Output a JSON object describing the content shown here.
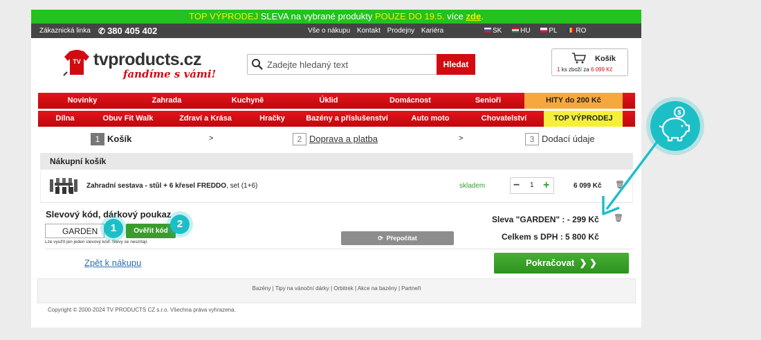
{
  "promo": {
    "part1": "TOP VÝPRODEJ",
    "part2": "SLEVA",
    "part3": "na vybrané produkty",
    "part4": "POUZE DO 19.5.",
    "part5": "více",
    "link": "zde",
    "end": "."
  },
  "topbar": {
    "customer_line": "Zákaznická linka",
    "phone": "380 405 402",
    "nav": [
      "Vše o nákupu",
      "Kontakt",
      "Prodejny",
      "Kariéra"
    ],
    "langs": [
      "SK",
      "HU",
      "PL",
      "RO"
    ]
  },
  "logo": {
    "brand": "tvproducts.cz",
    "slogan": "fandíme s vámi!",
    "badge": "TV"
  },
  "search": {
    "placeholder": "Zadejte hledaný text",
    "button": "Hledat"
  },
  "cart": {
    "title": "Košík",
    "count": "1",
    "mid": "ks zboží za",
    "price": "6 099 Kč"
  },
  "menu1": [
    "Novinky",
    "Zahrada",
    "Kuchyně",
    "Úklid",
    "Domácnost",
    "Senioři",
    "HITY do 200 Kč"
  ],
  "menu2": [
    "Dílna",
    "Obuv Fit Walk",
    "Zdraví a Krása",
    "Hračky",
    "Bazény a příslušenství",
    "Auto moto",
    "Chovatelství",
    "TOP VÝPRODEJ"
  ],
  "steps": [
    {
      "num": "1",
      "label": "Košík"
    },
    {
      "num": "2",
      "label": "Doprava a platba"
    },
    {
      "num": "3",
      "label": "Dodací údaje"
    }
  ],
  "step_arrow": ">",
  "panel": {
    "title": "Nákupní košík"
  },
  "item": {
    "name_bold": "Zahradní sestava - stůl + 6 křesel FREDDO",
    "name_rest": ", set (1+6)",
    "stock": "skladem",
    "qty": "1",
    "price": "6 099 Kč"
  },
  "coupon": {
    "title": "Slevový kód, dárkový poukaz",
    "value": "GARDEN",
    "button": "Ověřit kód",
    "note": "Lze využít jen jeden slevový kód. Slevy se nesčítají."
  },
  "recalc": "Přepočítat",
  "discount": "Sleva \"GARDEN\" : - 299 Kč",
  "total": "Celkem s DPH : 5 800 Kč",
  "back": "Zpět k nákupu",
  "continue": "Pokračovat",
  "footer_links": [
    "Bazény",
    "Tipy na vánoční dárky",
    "Orbitrek",
    "Akce na bazény",
    "Partneři"
  ],
  "footer_sep": "|",
  "copyright": "Copyright © 2000-2024 TV PRODUCTS CZ s.r.o. Všechna práva vyhrazena.",
  "annotations": {
    "badge1": "1",
    "badge2": "2"
  },
  "colors": {
    "promo_green": "#22c21f",
    "brand_red": "#d20a11",
    "accent_teal": "#1dbfc7",
    "cta_green": "#3a9d2b"
  }
}
